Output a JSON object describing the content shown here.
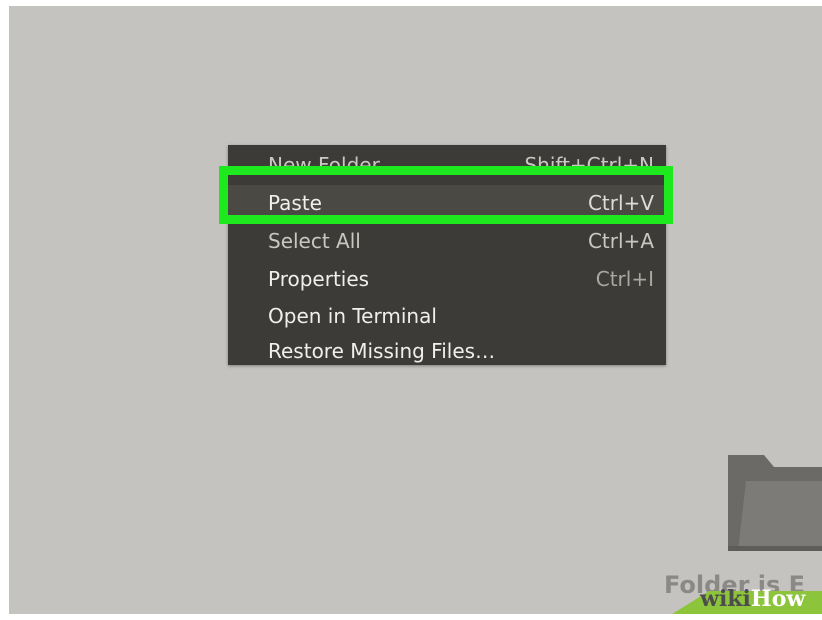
{
  "context_menu": {
    "items": [
      {
        "label": "New Folder",
        "shortcut": "Shift+Ctrl+N",
        "state": "partially-visible"
      },
      {
        "label": "Paste",
        "shortcut": "Ctrl+V",
        "state": "highlighted"
      },
      {
        "label": "Select All",
        "shortcut": "Ctrl+A",
        "state": "partially-visible"
      },
      {
        "label": "Properties",
        "shortcut": "Ctrl+I",
        "state": "enabled"
      },
      {
        "label": "Open in Terminal",
        "shortcut": "",
        "state": "enabled"
      },
      {
        "label": "Restore Missing Files…",
        "shortcut": "",
        "state": "enabled"
      }
    ]
  },
  "highlight": {
    "color": "#1ee81e",
    "target": "Paste"
  },
  "folder": {
    "icon": "folder-icon",
    "caption": "Folder is E"
  },
  "watermark": {
    "part_a": "wiki",
    "part_b": "How"
  },
  "colors": {
    "desktop_bg": "#c5c3c0",
    "menu_bg": "#3c3b37",
    "menu_text": "#f0efec",
    "highlight_border": "#1ee81e",
    "folder_icon": "#6b6a66"
  }
}
